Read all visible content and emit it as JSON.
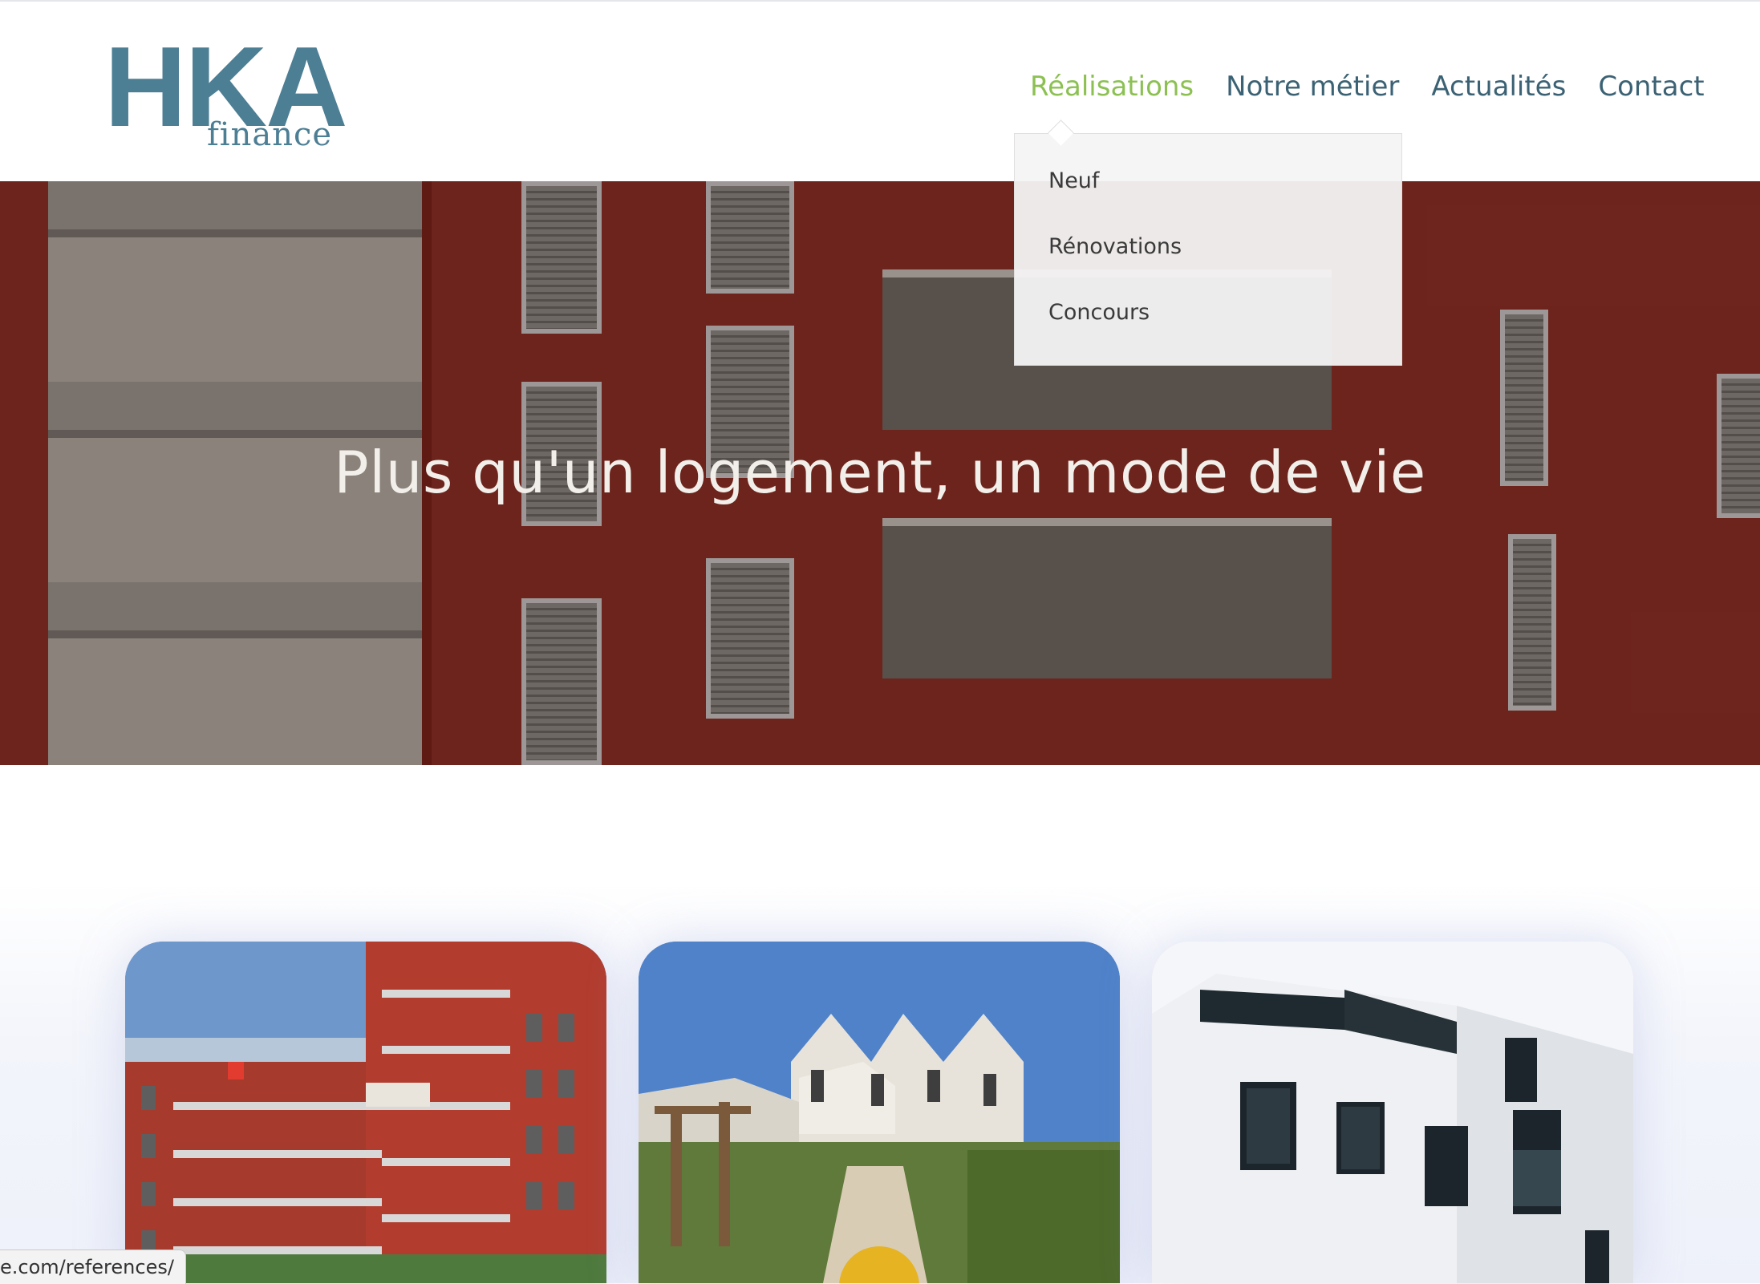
{
  "logo": {
    "main": "HKA",
    "sub": "finance"
  },
  "nav": {
    "items": [
      {
        "label": "Réalisations",
        "active": true
      },
      {
        "label": "Notre métier",
        "active": false
      },
      {
        "label": "Actualités",
        "active": false
      },
      {
        "label": "Contact",
        "active": false
      }
    ]
  },
  "dropdown": {
    "items": [
      "Neuf",
      "Rénovations",
      "Concours"
    ]
  },
  "hero": {
    "title": "Plus qu'un logement, un mode de vie"
  },
  "status_bar": {
    "url": "e.com/references/"
  },
  "colors": {
    "brand": "#4c7e94",
    "nav_text": "#3b6274",
    "nav_active": "#8cc152",
    "hero_facade": "#8d2f25"
  }
}
